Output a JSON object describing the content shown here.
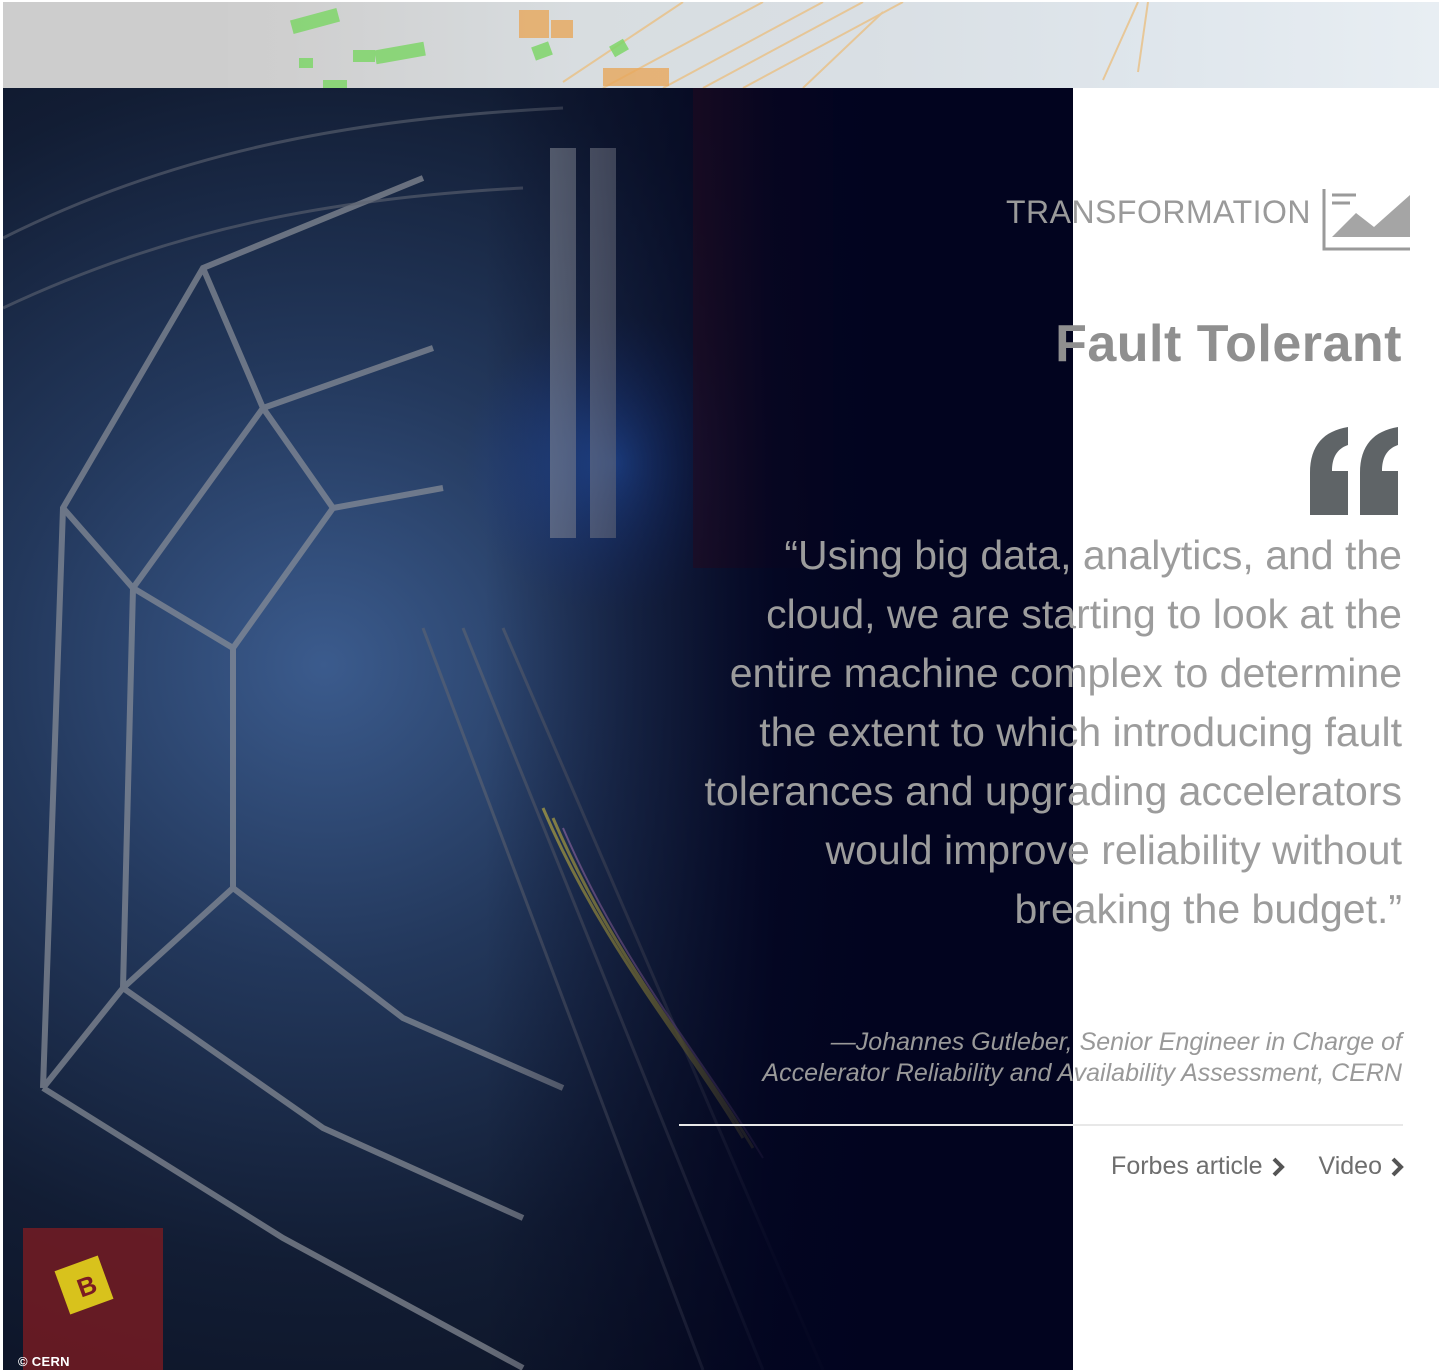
{
  "colors": {
    "page_bg": "#ffffff",
    "photo_dark": "#02041f",
    "text_gray": "#9c9c9c",
    "link_gray": "#6e6e6e",
    "quote_mark": "#5f6467"
  },
  "banner": {
    "image": "network-graph-banner"
  },
  "photo": {
    "image": "cern-accelerator-detector",
    "credit": "© CERN"
  },
  "header": {
    "category": "TRANSFORMATION",
    "category_icon": "trend-chart-icon"
  },
  "main": {
    "title": "Fault Tolerant",
    "quote_icon": "quote-mark-icon",
    "quote": "“Using big data, analytics, and the cloud, we are starting to look at the entire machine complex to determine the extent to which introducing fault tolerances and upgrading accelerators would improve reliability without breaking the budget.”",
    "attribution_line1": "—Johannes Gutleber, Senior Engineer in Charge of",
    "attribution_line2": "Accelerator Reliability and Availability Assessment, CERN"
  },
  "links": [
    {
      "label": "Forbes article",
      "icon": "chevron-right-icon"
    },
    {
      "label": "Video",
      "icon": "chevron-right-icon"
    }
  ]
}
